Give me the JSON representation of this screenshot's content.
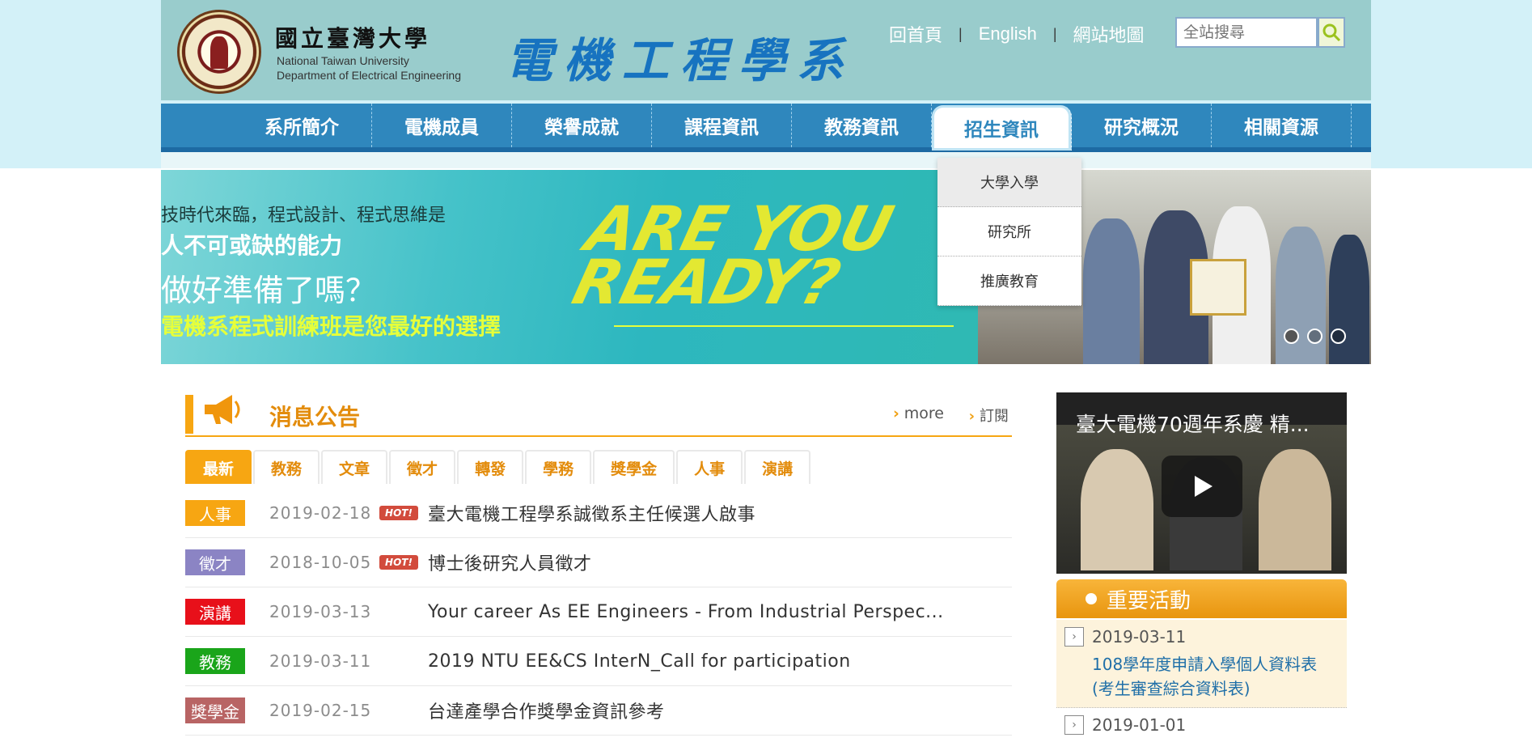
{
  "header": {
    "ntu_name_zh": "國立臺灣大學",
    "ntu_name_en": "National Taiwan University",
    "dept_name_en": "Department of Electrical Engineering",
    "dept_title": "電機工程學系",
    "links": {
      "home": "回首頁",
      "english": "English",
      "sitemap": "網站地圖"
    },
    "separator": "|",
    "search_placeholder": "全站搜尋"
  },
  "nav": {
    "items": [
      "系所簡介",
      "電機成員",
      "榮譽成就",
      "課程資訊",
      "教務資訊",
      "招生資訊",
      "研究概況",
      "相關資源"
    ],
    "active": "招生資訊"
  },
  "dropdown": {
    "items": [
      "大學入學",
      "研究所",
      "推廣教育"
    ]
  },
  "banner": {
    "line1": "技時代來臨，程式設計、程式思維是",
    "line2": "人不可或缺的能力",
    "line3": "做好準備了嗎？",
    "line4": "電機系程式訓練班是您最好的選擇",
    "ready1": "ARE YOU",
    "ready2": "READY?"
  },
  "news": {
    "title": "消息公告",
    "more": "more",
    "subscribe": "訂閱",
    "tabs": [
      "最新",
      "教務",
      "文章",
      "徵才",
      "轉發",
      "學務",
      "獎學金",
      "人事",
      "演講"
    ],
    "hot_label": "HOT!",
    "items": [
      {
        "category": "人事",
        "color": "#f7a612",
        "date": "2019-02-18",
        "hot": true,
        "title": "臺大電機工程學系誠徵系主任候選人啟事"
      },
      {
        "category": "徵才",
        "color": "#8b84c4",
        "date": "2018-10-05",
        "hot": true,
        "title": "博士後研究人員徵才"
      },
      {
        "category": "演講",
        "color": "#e8101a",
        "date": "2019-03-13",
        "hot": false,
        "title": "Your career As EE Engineers - From Industrial Perspec..."
      },
      {
        "category": "教務",
        "color": "#1aa51a",
        "date": "2019-03-11",
        "hot": false,
        "title": "2019 NTU EE&CS InterN_Call for participation"
      },
      {
        "category": "獎學金",
        "color": "#b86464",
        "date": "2019-02-15",
        "hot": false,
        "title": "台達產學合作獎學金資訊參考"
      }
    ]
  },
  "video": {
    "title": "臺大電機70週年系慶 精..."
  },
  "events": {
    "title": "重要活動",
    "items": [
      {
        "date": "2019-03-11",
        "text": "108學年度申請入學個人資料表(考生審查綜合資料表)"
      },
      {
        "date": "2019-01-01",
        "text": ""
      }
    ]
  }
}
